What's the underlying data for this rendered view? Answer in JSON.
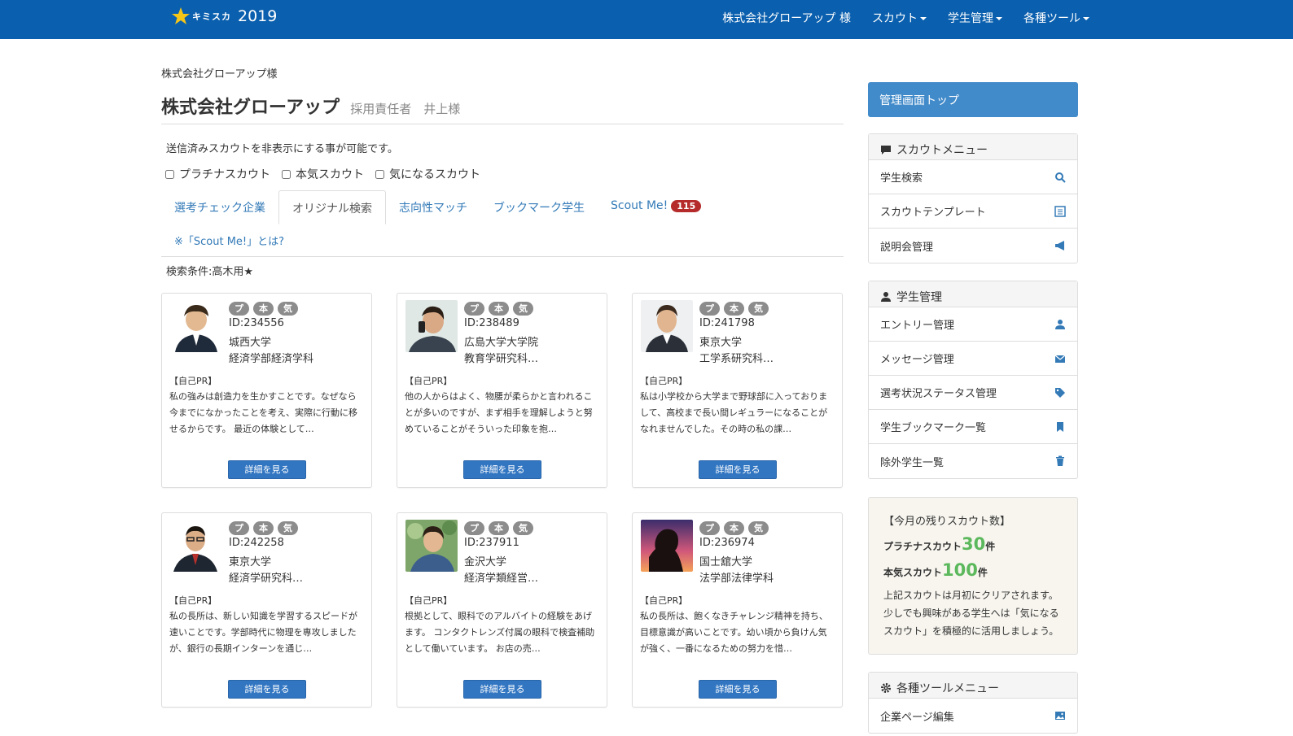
{
  "nav": {
    "brand_logo": "キミスカ",
    "brand_year": "2019",
    "company": "株式会社グローアップ 様",
    "menu": [
      "スカウト",
      "学生管理",
      "各種ツール"
    ]
  },
  "breadcrumb": "株式会社グローアップ様",
  "header": {
    "company_name": "株式会社グローアップ",
    "recruiter": "採用責任者　井上様"
  },
  "notice": "送信済みスカウトを非表示にする事が可能です。",
  "filters": [
    "プラチナスカウト",
    "本気スカウト",
    "気になるスカウト"
  ],
  "tabs": [
    {
      "label": "選考チェック企業"
    },
    {
      "label": "オリジナル検索"
    },
    {
      "label": "志向性マッチ"
    },
    {
      "label": "ブックマーク学生"
    },
    {
      "label": "Scout Me!",
      "badge": "115"
    }
  ],
  "scoutme_link": "※「Scout Me!」とは?",
  "condition": "検索条件:高木用★",
  "marks": [
    "プ",
    "本",
    "気"
  ],
  "pr_label": "【自己PR】",
  "detail_label": "詳細を見る",
  "cards": [
    {
      "id": "ID:234556",
      "school": "城西大学",
      "dept": "経済学部経済学科",
      "pr": "私の強みは創造力を生かすことです。なぜなら今までになかったことを考え、実際に行動に移せるからです。 最近の体験として…"
    },
    {
      "id": "ID:238489",
      "school": "広島大学大学院",
      "dept": "教育学研究科…",
      "pr": "他の人からはよく、物腰が柔らかと言われることが多いのですが、まず相手を理解しようと努めていることがそういった印象を抱…"
    },
    {
      "id": "ID:241798",
      "school": "東京大学",
      "dept": "工学系研究科…",
      "pr": "私は小学校から大学まで野球部に入っておりまして、高校まで長い間レギュラーになることがなれませんでした。その時の私の課…"
    },
    {
      "id": "ID:242258",
      "school": "東京大学",
      "dept": "経済学研究科…",
      "pr": "私の長所は、新しい知識を学習するスピードが速いことです。学部時代に物理を専攻しましたが、銀行の長期インターンを通じ…"
    },
    {
      "id": "ID:237911",
      "school": "金沢大学",
      "dept": "経済学類経営…",
      "pr": "根拠として、眼科でのアルバイトの経験をあげます。 コンタクトレンズ付属の眼科で検査補助として働いています。 お店の売…"
    },
    {
      "id": "ID:236974",
      "school": "国士舘大学",
      "dept": "法学部法律学科",
      "pr": "私の長所は、飽くなきチャレンジ精神を持ち、目標意識が高いことです。幼い頃から負けん気が強く、一番になるための努力を惜…"
    }
  ],
  "sidebar": {
    "top_button": "管理画面トップ",
    "scout_menu": {
      "title": "スカウトメニュー",
      "items": [
        {
          "label": "学生検索",
          "icon": "search-icon"
        },
        {
          "label": "スカウトテンプレート",
          "icon": "list-icon"
        },
        {
          "label": "説明会管理",
          "icon": "bullhorn-icon"
        }
      ]
    },
    "student_menu": {
      "title": "学生管理",
      "items": [
        {
          "label": "エントリー管理",
          "icon": "user-icon"
        },
        {
          "label": "メッセージ管理",
          "icon": "envelope-icon"
        },
        {
          "label": "選考状況ステータス管理",
          "icon": "tags-icon"
        },
        {
          "label": "学生ブックマーク一覧",
          "icon": "bookmark-icon"
        },
        {
          "label": "除外学生一覧",
          "icon": "trash-icon"
        }
      ]
    },
    "remaining": {
      "title": "【今月の残りスカウト数】",
      "platinum_label": "プラチナスカウト",
      "platinum_value": "30",
      "honki_label": "本気スカウト",
      "honki_value": "100",
      "unit": "件",
      "note": "上記スカウトは月初にクリアされます。少しでも興味がある学生へは「気になるスカウト」を積極的に活用しましょう。"
    },
    "tools_menu": {
      "title": "各種ツールメニュー",
      "items": [
        {
          "label": "企業ページ編集",
          "icon": "image-icon"
        }
      ]
    }
  },
  "colors": {
    "nav_bg": "#0a5fae",
    "link": "#337ab7",
    "button": "#3276c2",
    "badge": "#b52a2a",
    "accent_green": "#5cb85c"
  }
}
